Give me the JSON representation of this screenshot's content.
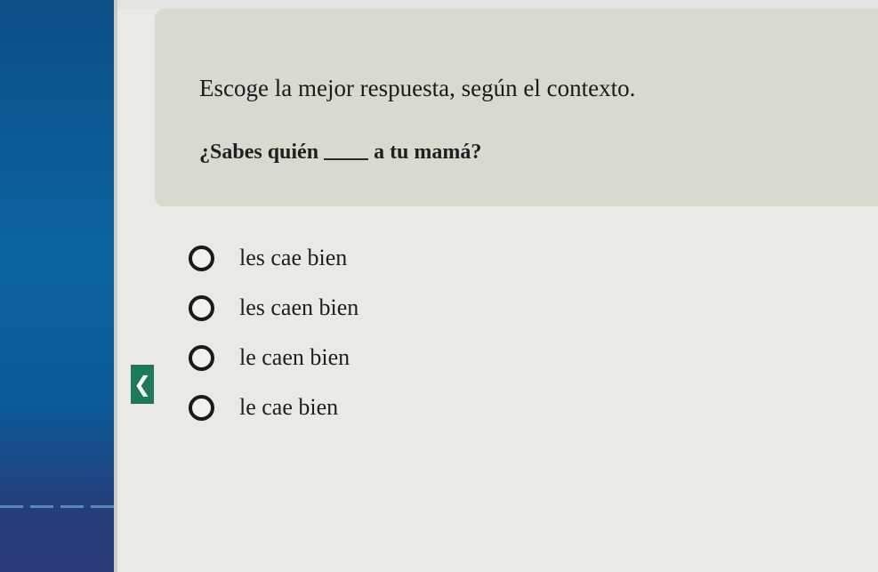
{
  "question": {
    "instructions": "Escoge la mejor respuesta, según el contexto.",
    "prompt_before": "¿Sabes quién",
    "prompt_after": "a tu mamá?"
  },
  "options": [
    {
      "label": "les cae bien"
    },
    {
      "label": "les caen bien"
    },
    {
      "label": "le caen bien"
    },
    {
      "label": "le cae bien"
    }
  ],
  "nav": {
    "back_glyph": "❮",
    "back_icon": "chevron-left-icon"
  },
  "colors": {
    "sidebar": "#0c64a0",
    "back_button": "#1c7a5a",
    "question_box": "#d8d9cf",
    "page_background": "#e9eae5"
  }
}
